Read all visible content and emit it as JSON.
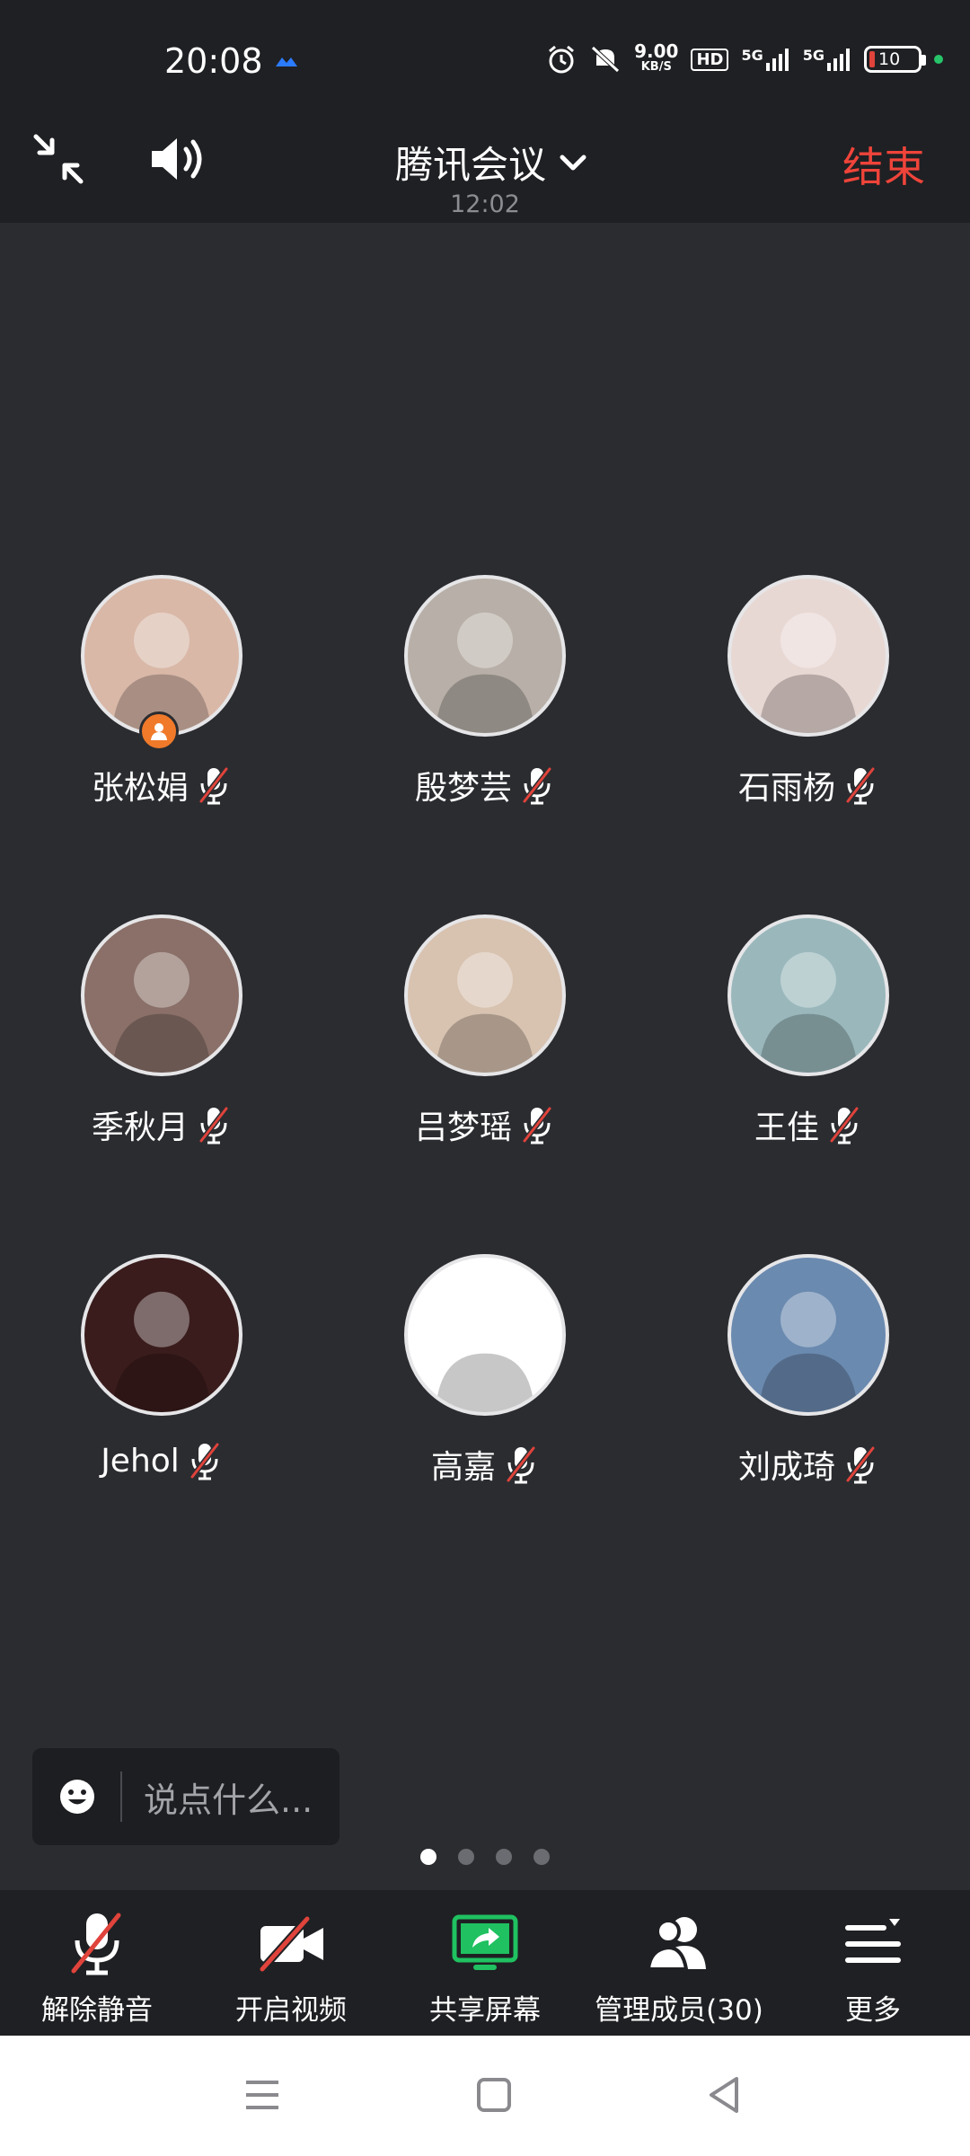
{
  "status_bar": {
    "time": "20:08",
    "net_speed_value": "9.00",
    "net_speed_unit": "KB/S",
    "hd_badge": "HD",
    "signal_1": "5G",
    "signal_2": "5G",
    "battery": "10"
  },
  "header": {
    "title": "腾讯会议",
    "timer": "12:02",
    "end_label": "结束"
  },
  "participants": [
    {
      "name": "张松娟",
      "muted": true,
      "host": true,
      "avatar_color": "#d9b8a8"
    },
    {
      "name": "殷梦芸",
      "muted": true,
      "host": false,
      "avatar_color": "#b8b0a8"
    },
    {
      "name": "石雨杨",
      "muted": true,
      "host": false,
      "avatar_color": "#e8d8d4"
    },
    {
      "name": "季秋月",
      "muted": true,
      "host": false,
      "avatar_color": "#8a7068"
    },
    {
      "name": "吕梦瑶",
      "muted": true,
      "host": false,
      "avatar_color": "#d8c2b0"
    },
    {
      "name": "王佳",
      "muted": true,
      "host": false,
      "avatar_color": "#9ab8bc"
    },
    {
      "name": "Jehol",
      "muted": true,
      "host": false,
      "avatar_color": "#3a1c1c"
    },
    {
      "name": "高嘉",
      "muted": true,
      "host": false,
      "avatar_color": "#ffffff"
    },
    {
      "name": "刘成琦",
      "muted": true,
      "host": false,
      "avatar_color": "#6b8ab0"
    }
  ],
  "chat": {
    "placeholder": "说点什么..."
  },
  "pagination": {
    "total": 4,
    "active_index": 0
  },
  "toolbar": {
    "unmute_label": "解除静音",
    "video_label": "开启视频",
    "share_label": "共享屏幕",
    "members_label": "管理成员(30)",
    "more_label": "更多"
  },
  "colors": {
    "end_red": "#f0443a",
    "share_green": "#1fc160",
    "host_orange": "#f07a2a",
    "background": "#2b2c30"
  }
}
